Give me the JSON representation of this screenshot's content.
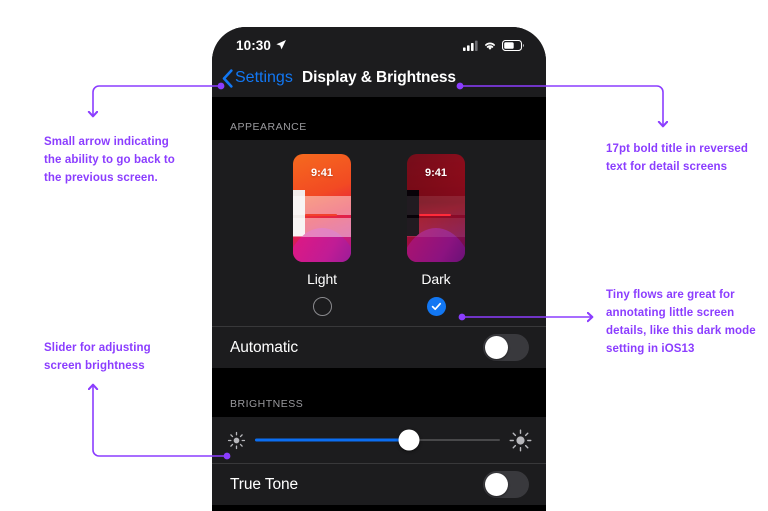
{
  "accent": "#8B3DFF",
  "blue": "#1277F3",
  "slider_blue": "#0B6EF2",
  "annotations": [
    {
      "id": "back",
      "lines": [
        "Small arrow indicating",
        "the ability to go back to",
        "the previous screen."
      ]
    },
    {
      "id": "title",
      "lines": [
        "17pt bold title in reversed",
        "text for detail screens"
      ]
    },
    {
      "id": "darkmode",
      "lines": [
        "Tiny flows are great for",
        "annotating little screen",
        "details, like this dark mode",
        "setting in iOS13"
      ]
    },
    {
      "id": "slider",
      "lines": [
        "Slider for  adjusting",
        "screen brightness"
      ]
    }
  ],
  "phone": {
    "statusbar": {
      "time": "10:30",
      "location_icon": "location-arrow-icon",
      "cellular_icon": "cellular-signal-icon",
      "wifi_icon": "wifi-icon",
      "battery_icon": "battery-icon"
    },
    "navbar": {
      "back_label": "Settings",
      "back_icon": "chevron-left-icon",
      "title": "Display & Brightness"
    },
    "appearance": {
      "section_title": "APPEARANCE",
      "options": [
        {
          "label": "Light",
          "time": "9:41",
          "selected": false
        },
        {
          "label": "Dark",
          "time": "9:41",
          "selected": true
        }
      ],
      "check_icon": "check-icon",
      "automatic": {
        "label": "Automatic",
        "value": "off"
      }
    },
    "brightness": {
      "section_title": "BRIGHTNESS",
      "low_icon": "brightness-low-icon",
      "high_icon": "brightness-high-icon",
      "value_percent": 63,
      "true_tone": {
        "label": "True Tone",
        "value": "off"
      }
    }
  }
}
